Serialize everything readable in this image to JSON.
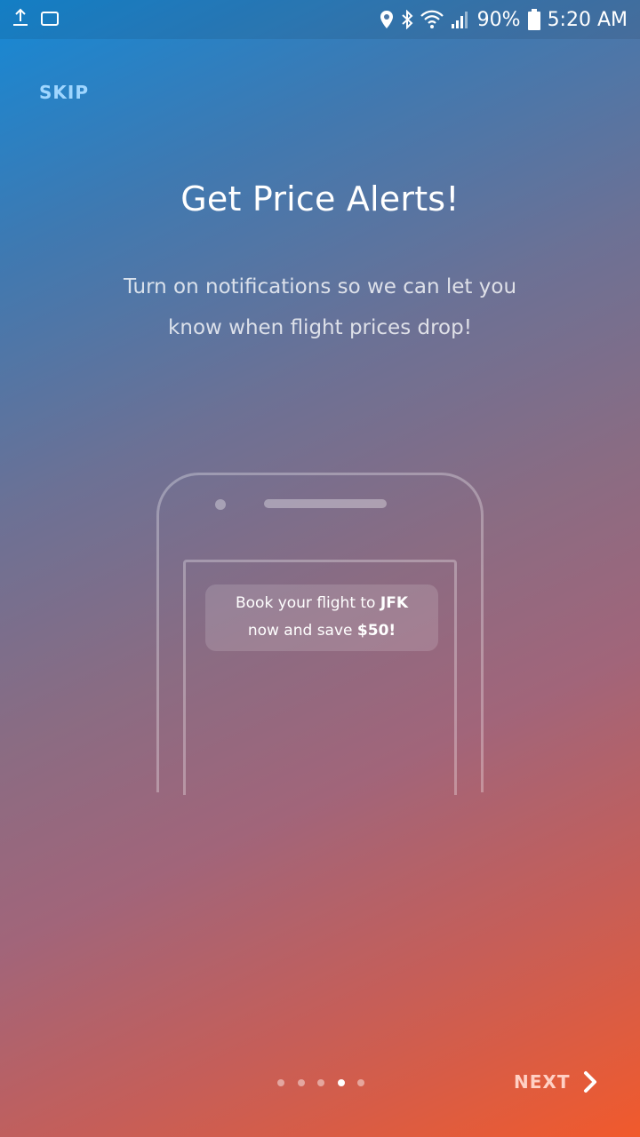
{
  "status_bar": {
    "battery": "90%",
    "time": "5:20 AM",
    "icons": [
      "location-icon",
      "bluetooth-icon",
      "wifi-icon",
      "signal-icon",
      "battery-icon"
    ]
  },
  "skip_label": "SKIP",
  "title": "Get Price Alerts!",
  "subtitle": "Turn on notifications so we can let you know when flight prices drop!",
  "illustration": {
    "notification": {
      "line1_prefix": "Book your flight to ",
      "line1_bold": "JFK",
      "line2_prefix": "now and save ",
      "line2_bold": "$50!"
    }
  },
  "pager": {
    "total": 5,
    "active_index": 3
  },
  "next_label": "NEXT",
  "colors": {
    "gradient_top": "#1589d6",
    "gradient_bottom": "#f15a2c",
    "skip": "#9fd6ff"
  }
}
